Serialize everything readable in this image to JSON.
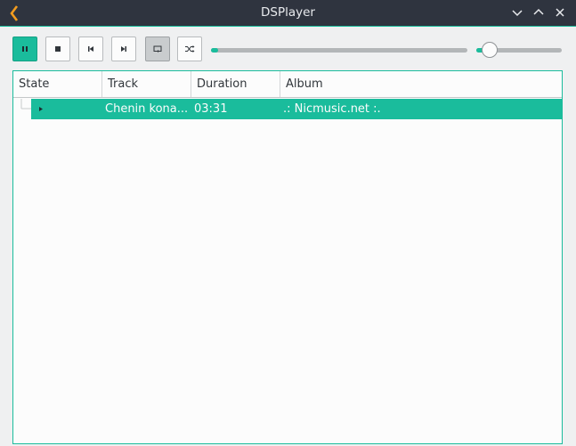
{
  "window": {
    "title": "DSPlayer",
    "accent_color": "#1abc9c",
    "logo_color": "#f39c1f",
    "logo_icon": "chevron-left-icon",
    "controls": [
      "minimize-icon",
      "maximize-icon",
      "close-icon"
    ]
  },
  "toolbar": {
    "buttons": [
      {
        "name": "pause-button",
        "icon": "pause-icon",
        "active": true
      },
      {
        "name": "stop-button",
        "icon": "stop-icon",
        "active": false
      },
      {
        "name": "previous-button",
        "icon": "skip-previous-icon",
        "active": false
      },
      {
        "name": "next-button",
        "icon": "skip-next-icon",
        "active": false
      },
      {
        "name": "repeat-button",
        "icon": "repeat-icon",
        "toggled": true
      },
      {
        "name": "shuffle-button",
        "icon": "shuffle-icon",
        "active": false
      }
    ],
    "progress_fraction": 0.02,
    "volume_fraction": 0.16
  },
  "playlist": {
    "columns": [
      "State",
      "Track",
      "Duration",
      "Album"
    ],
    "rows": [
      {
        "state": "playing",
        "track": "Chenin kona...",
        "duration": "03:31",
        "album": ".: Nicmusic.net :."
      }
    ]
  }
}
